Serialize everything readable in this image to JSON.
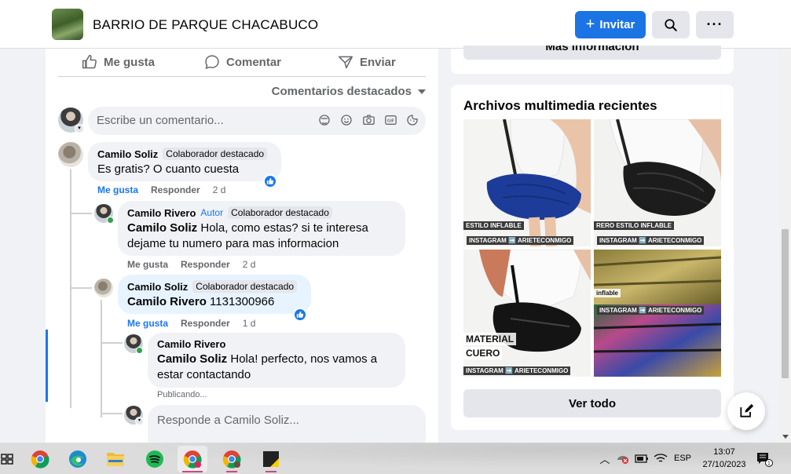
{
  "header": {
    "group_name": "BARRIO DE PARQUE CHACABUCO",
    "invite_label": "Invitar",
    "more_label": "···"
  },
  "post_actions": {
    "like": "Me gusta",
    "comment": "Comentar",
    "send": "Enviar"
  },
  "comments_sort": "Comentarios destacados",
  "comment_input": {
    "placeholder": "Escribe un comentario..."
  },
  "comments": [
    {
      "author": "Camilo Soliz",
      "tag": "Colaborador destacado",
      "text": "Es gratis? O cuanto cuesta",
      "like_label": "Me gusta",
      "reply_label": "Responder",
      "time": "2 d"
    }
  ],
  "replies": [
    {
      "author": "Camilo Rivero",
      "author_tag": "Autor",
      "tag": "Colaborador destacado",
      "mention": "Camilo Soliz",
      "text_line1": " Hola, como estas? si te interesa",
      "text_line2": "dejame tu numero para mas informacion",
      "like_label": "Me gusta",
      "reply_label": "Responder",
      "time": "2 d"
    },
    {
      "author": "Camilo Soliz",
      "tag": "Colaborador destacado",
      "mention": "Camilo Rivero",
      "text": " 1131300966",
      "like_label": "Me gusta",
      "reply_label": "Responder",
      "time": "1 d"
    },
    {
      "author": "Camilo Rivero",
      "mention": "Camilo Soliz",
      "text_line1": " Hola! perfecto, nos vamos a",
      "text_line2": "estar contactando",
      "status": "Publicando..."
    }
  ],
  "reply_input": {
    "placeholder": "Responde a Camilo Soliz..."
  },
  "right_panel": {
    "more_info_label": "Más información",
    "media_title": "Archivos multimedia recientes",
    "media_labels": [
      "ESTILO INFLABLE",
      "INSTAGRAM ➡️ ARIETECONMIGO",
      "RERO ESTILO INFLABLE",
      "INSTAGRAM ➡️ ARIETECONMIGO",
      "MATERIAL",
      "CUERO",
      "INSTAGRAM ➡️ ARIETECONMIGO",
      "inflable",
      "INSTAGRAM ➡️ ARIETECONMIGO"
    ],
    "view_all_label": "Ver todo"
  },
  "taskbar": {
    "language": "ESP",
    "time": "13:07",
    "date": "27/10/2023",
    "notification_count": "1"
  },
  "colors": {
    "accent": "#1b74e4",
    "link_blue": "#1877f2",
    "online_green": "#31a24c"
  }
}
